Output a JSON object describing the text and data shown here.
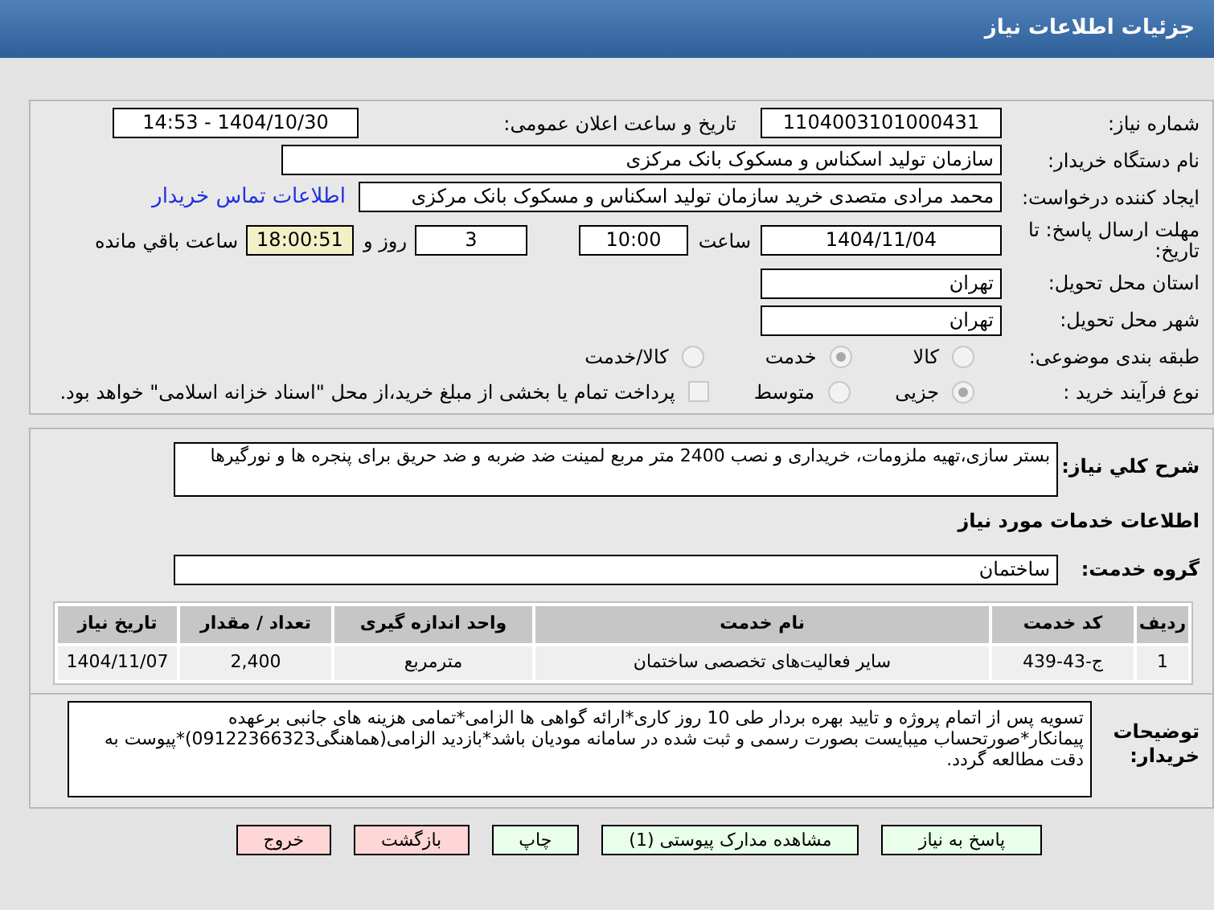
{
  "header": {
    "title": "جزئیات اطلاعات نیاز"
  },
  "fields": {
    "need_number": {
      "label": "شماره نیاز:",
      "value": "1104003101000431"
    },
    "announce": {
      "label": "تاریخ و ساعت اعلان عمومی:",
      "value": "1404/10/30 - 14:53"
    },
    "buyer_org": {
      "label": "نام دستگاه خریدار:",
      "value": "سازمان تولید اسکناس و مسکوک بانک مرکزی"
    },
    "creator": {
      "label": "ایجاد کننده درخواست:",
      "value": "محمد مرادی متصدی خرید سازمان تولید اسکناس و مسکوک بانک مرکزی",
      "link": "اطلاعات تماس خریدار"
    },
    "deadline": {
      "label": "مهلت ارسال پاسخ: تا تاریخ:",
      "date": "1404/11/04",
      "time_label": "ساعت",
      "time": "10:00",
      "days": "3",
      "days_label": "روز و",
      "remaining": "18:00:51",
      "remaining_label": "ساعت باقي مانده"
    },
    "province": {
      "label": "استان محل تحویل:",
      "value": "تهران"
    },
    "city": {
      "label": "شهر محل تحویل:",
      "value": "تهران"
    }
  },
  "category": {
    "label": "طبقه بندی موضوعی:",
    "options": [
      {
        "label": "کالا",
        "selected": false
      },
      {
        "label": "خدمت",
        "selected": true
      },
      {
        "label": "کالا/خدمت",
        "selected": false
      }
    ]
  },
  "purchase_type": {
    "label": "نوع فرآیند خرید :",
    "options": [
      {
        "label": "جزیی",
        "selected": true
      },
      {
        "label": "متوسط",
        "selected": false
      }
    ],
    "payment": {
      "checked": false,
      "label": "پرداخت تمام یا بخشی از مبلغ خرید،از محل \"اسناد خزانه اسلامی\" خواهد بود."
    }
  },
  "summary": {
    "label": "شرح کلي نياز:",
    "value": "بستر سازی،تهیه ملزومات، خریداری و نصب 2400 متر مربع لمینت ضد ضربه و ضد حریق برای پنجره ها و نورگیرها"
  },
  "services_heading": "اطلاعات خدمات مورد نیاز",
  "service_group": {
    "label": "گروه خدمت:",
    "value": "ساختمان"
  },
  "table": {
    "columns": [
      "ردیف",
      "کد خدمت",
      "نام خدمت",
      "واحد اندازه گیری",
      "تعداد / مقدار",
      "تاریخ نیاز"
    ],
    "rows": [
      [
        "1",
        "ج-43-439",
        "سایر فعالیت‌های تخصصی ساختمان",
        "مترمربع",
        "2,400",
        "1404/11/07"
      ]
    ]
  },
  "notes": {
    "label": "توضیحات خریدار:",
    "value": "تسویه پس از اتمام پروژه و تایید بهره بردار طی 10 روز کاری*ارائه گواهی ها الزامی*تمامی هزینه های جانبی برعهده پیمانکار*صورتحساب میبایست بصورت رسمی و ثبت شده در سامانه مودیان باشد*بازدید الزامی(هماهنگی09122366323)*پیوست به دقت مطالعه گردد."
  },
  "buttons": [
    {
      "label": "پاسخ به نیاز",
      "kind": "action"
    },
    {
      "label": "مشاهده مدارک پیوستی (1)",
      "kind": "action"
    },
    {
      "label": "چاپ",
      "kind": "action"
    },
    {
      "label": "بازگشت",
      "kind": "exit"
    },
    {
      "label": "خروج",
      "kind": "exit"
    }
  ]
}
